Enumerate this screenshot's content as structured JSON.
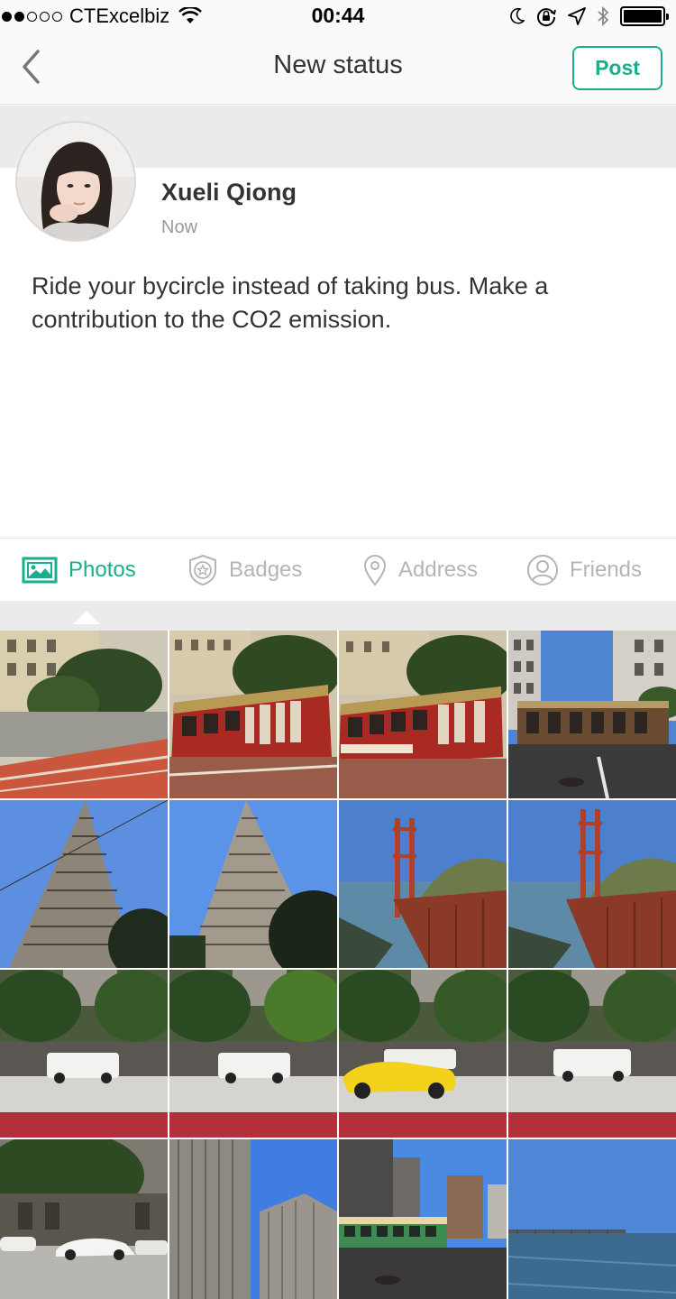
{
  "status_bar": {
    "carrier": "CTExcelbiz",
    "time": "00:44",
    "signal_bars_filled": 2,
    "signal_bars_total": 5,
    "battery_level": 1.0,
    "icons": [
      "wifi-icon",
      "moon-icon",
      "rotation-lock-icon",
      "location-arrow-icon",
      "bluetooth-icon",
      "battery-icon"
    ]
  },
  "nav": {
    "back_icon": "chevron-left-icon",
    "title": "New status",
    "post_label": "Post"
  },
  "post": {
    "user_name": "Xueli Qiong",
    "timestamp": "Now",
    "text": "Ride your bycircle instead of taking bus.  Make a contribution to the CO2 emission."
  },
  "tabs": [
    {
      "label": "Photos",
      "icon": "photos-icon",
      "active": true
    },
    {
      "label": "Badges",
      "icon": "badge-icon",
      "active": false
    },
    {
      "label": "Address",
      "icon": "location-pin-icon",
      "active": false
    },
    {
      "label": "Friends",
      "icon": "person-icon",
      "active": false
    }
  ],
  "colors": {
    "accent": "#1aae8c",
    "inactive_tab": "#b5b5b5",
    "background_gray": "#ebebeb"
  },
  "photos": [
    {
      "subject": "street"
    },
    {
      "subject": "cable-car"
    },
    {
      "subject": "cable-car"
    },
    {
      "subject": "cable-car-street"
    },
    {
      "subject": "tower"
    },
    {
      "subject": "tower"
    },
    {
      "subject": "bridge"
    },
    {
      "subject": "bridge"
    },
    {
      "subject": "van"
    },
    {
      "subject": "van"
    },
    {
      "subject": "yellow-car"
    },
    {
      "subject": "van"
    },
    {
      "subject": "street-cars"
    },
    {
      "subject": "skyscrapers"
    },
    {
      "subject": "streetcar-city"
    },
    {
      "subject": "bay"
    }
  ]
}
